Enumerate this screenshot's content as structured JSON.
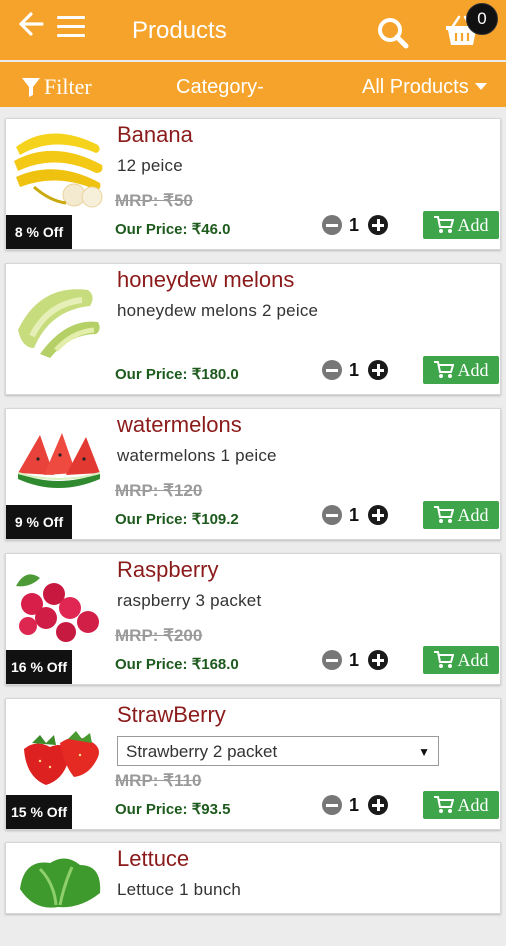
{
  "header": {
    "title": "Products",
    "cart_count": "0"
  },
  "filterbar": {
    "filter_label": "Filter",
    "category_label": "Category-",
    "products_label": "All Products"
  },
  "products": [
    {
      "name": "Banana",
      "desc": "12 peice",
      "mrp": "MRP: ₹50",
      "price": "Our Price: ₹46.0",
      "off": "8 % Off",
      "qty": "1",
      "add": "Add"
    },
    {
      "name": "honeydew melons",
      "desc": "honeydew melons 2 peice",
      "mrp": "",
      "price": "Our Price: ₹180.0",
      "off": "",
      "qty": "1",
      "add": "Add"
    },
    {
      "name": "watermelons",
      "desc": "watermelons 1 peice",
      "mrp": "MRP: ₹120",
      "price": "Our Price: ₹109.2",
      "off": "9 % Off",
      "qty": "1",
      "add": "Add"
    },
    {
      "name": "Raspberry",
      "desc": "raspberry 3 packet",
      "mrp": "MRP: ₹200",
      "price": "Our Price: ₹168.0",
      "off": "16 % Off",
      "qty": "1",
      "add": "Add"
    },
    {
      "name": "StrawBerry",
      "desc": "Strawberry 2 packet",
      "mrp": "MRP: ₹110",
      "price": "Our Price: ₹93.5",
      "off": "15 % Off",
      "qty": "1",
      "add": "Add"
    },
    {
      "name": "Lettuce",
      "desc": "Lettuce 1 bunch",
      "mrp": "",
      "price": "",
      "off": "",
      "qty": "",
      "add": ""
    }
  ],
  "colors": {
    "primary": "#f5a32b",
    "add_button": "#3fa54a",
    "product_name": "#8b1a1a",
    "price_text": "#1d5a1d"
  },
  "icons": [
    "back-arrow-icon",
    "menu-icon",
    "search-icon",
    "basket-icon",
    "filter-icon",
    "cart-icon",
    "minus-icon",
    "plus-icon"
  ]
}
